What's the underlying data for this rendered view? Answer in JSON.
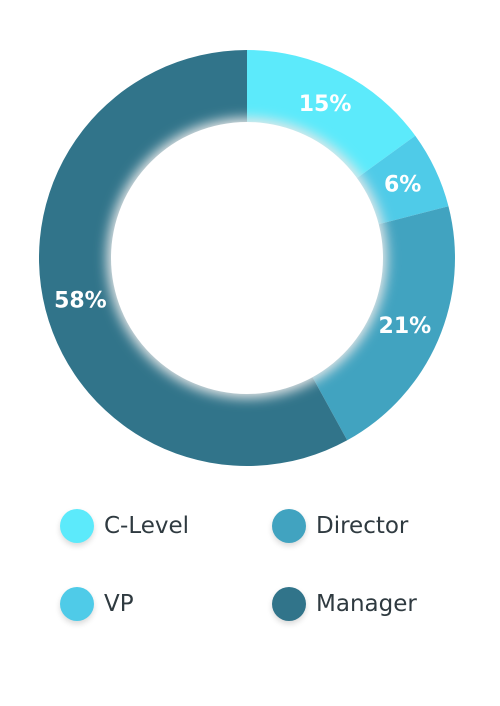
{
  "chart_data": {
    "type": "pie",
    "donut": true,
    "categories": [
      "C-Level",
      "VP",
      "Director",
      "Manager"
    ],
    "values": [
      15,
      6,
      21,
      58
    ],
    "value_labels": [
      "15%",
      "6%",
      "21%",
      "58%"
    ],
    "colors": [
      "#5ceafb",
      "#4fcbe8",
      "#41a3c0",
      "#31748a"
    ],
    "legend_position": "bottom",
    "title": "",
    "legend": [
      {
        "label": "C-Level",
        "color": "#5ceafb"
      },
      {
        "label": "Director",
        "color": "#41a3c0"
      },
      {
        "label": "VP",
        "color": "#4fcbe8"
      },
      {
        "label": "Manager",
        "color": "#31748a"
      }
    ]
  }
}
